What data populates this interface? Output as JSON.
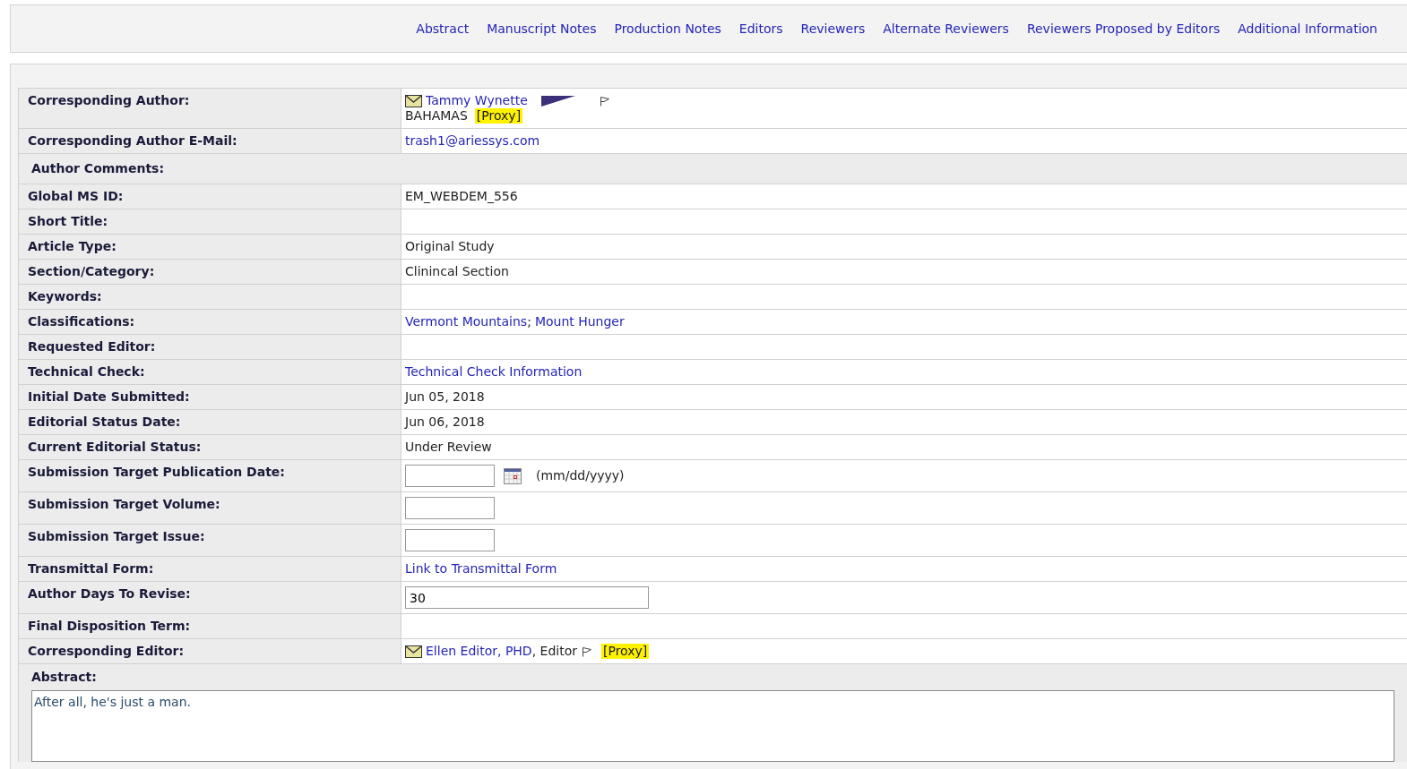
{
  "nav_links": [
    "Abstract",
    "Manuscript Notes",
    "Production Notes",
    "Editors",
    "Reviewers",
    "Alternate Reviewers",
    "Reviewers Proposed by Editors",
    "Additional Information"
  ],
  "rows": [
    {
      "kind": "author",
      "label": "Corresponding Author:",
      "name": "Tammy Wynette",
      "country": "BAHAMAS",
      "proxy": "[Proxy]"
    },
    {
      "kind": "link",
      "label": "Corresponding Author E-Mail:",
      "value": "trash1@ariessys.com"
    },
    {
      "kind": "section",
      "label": "Author Comments:"
    },
    {
      "kind": "text",
      "label": "Global MS ID:",
      "value": "EM_WEBDEM_556"
    },
    {
      "kind": "text",
      "label": "Short Title:"
    },
    {
      "kind": "text",
      "label": "Article Type:",
      "value": "Original Study"
    },
    {
      "kind": "text",
      "label": "Section/Category:",
      "value": "Clinincal Section"
    },
    {
      "kind": "text",
      "label": "Keywords:"
    },
    {
      "kind": "links",
      "label": "Classifications:",
      "links": [
        "Vermont Mountains",
        "Mount Hunger"
      ],
      "separator": ";"
    },
    {
      "kind": "text",
      "label": "Requested Editor:"
    },
    {
      "kind": "link",
      "label": "Technical Check:",
      "value": "Technical Check Information"
    },
    {
      "kind": "text",
      "label": "Initial Date Submitted:",
      "value": "Jun 05, 2018"
    },
    {
      "kind": "text",
      "label": "Editorial Status Date:",
      "value": "Jun 06, 2018"
    },
    {
      "kind": "text",
      "label": "Current Editorial Status:",
      "value": "Under Review"
    },
    {
      "kind": "date_input",
      "label": "Submission Target Publication Date:",
      "hint": "(mm/dd/yyyy)"
    },
    {
      "kind": "input",
      "label": "Submission Target Volume:"
    },
    {
      "kind": "input",
      "label": "Submission Target Issue:"
    },
    {
      "kind": "link",
      "label": "Transmittal Form:",
      "value": "Link to Transmittal Form"
    },
    {
      "kind": "wide_input",
      "label": "Author Days To Revise:",
      "value": "30"
    },
    {
      "kind": "text",
      "label": "Final Disposition Term:"
    },
    {
      "kind": "editor",
      "label": "Corresponding Editor:",
      "name": "Ellen Editor, PHD",
      "role": ", Editor",
      "proxy": "[Proxy]"
    }
  ],
  "abstract": {
    "label": "Abstract:",
    "text": "After all, he's just a man."
  }
}
